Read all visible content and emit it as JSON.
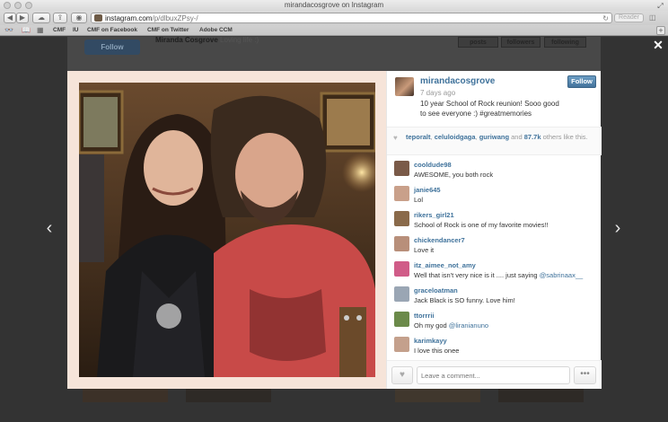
{
  "window": {
    "title": "mirandacosgrove on Instagram"
  },
  "toolbar": {
    "url_host": "instagram.com",
    "url_path": "/p/dlbuxZPsy-/",
    "reader_label": "Reader"
  },
  "bookmarks": {
    "items": [
      "CMF",
      "IU",
      "CMF on Facebook",
      "CMF on Twitter",
      "Adobe CCM"
    ]
  },
  "background_page": {
    "follow_label": "Follow",
    "profile_name": "Miranda Cosgrove",
    "profile_tagline": "Loving life :)",
    "stats": [
      "posts",
      "followers",
      "following"
    ]
  },
  "post": {
    "owner": "mirandacosgrove",
    "time": "7 days ago",
    "caption": "10 year School of Rock reunion! Sooo good to see everyone :) #greatmemories",
    "follow_label": "Follow"
  },
  "likes": {
    "users": [
      "teporalt",
      "celuloidgaga",
      "guriwang"
    ],
    "connector": "and",
    "others": "87.7k",
    "suffix": "others like this."
  },
  "comments": [
    {
      "user": "cooldude98",
      "text": "AWESOME, you both rock",
      "mention": ""
    },
    {
      "user": "janie645",
      "text": "Lol",
      "mention": ""
    },
    {
      "user": "rikers_girl21",
      "text": "School of Rock is one of my favorite movies!!",
      "mention": ""
    },
    {
      "user": "chickendancer7",
      "text": "Love it",
      "mention": ""
    },
    {
      "user": "itz_aimee_not_amy",
      "text": "Well that isn't very nice is it .... just saying ",
      "mention": "@sabrinaax__"
    },
    {
      "user": "graceloatman",
      "text": "Jack Black is SO funny. Love him!",
      "mention": ""
    },
    {
      "user": "ttorrrii",
      "text": "Oh my god ",
      "mention": "@liranianuno"
    },
    {
      "user": "karimkayy",
      "text": "I love this onee",
      "mention": ""
    }
  ],
  "composer": {
    "placeholder": "Leave a comment...",
    "more_label": "•••"
  },
  "icons": {
    "close": "close-icon",
    "prev": "chevron-left-icon",
    "next": "chevron-right-icon",
    "heart": "heart-icon"
  },
  "colors": {
    "link": "#3f729b",
    "follow_button": "#517fa4",
    "overlay": "#333333",
    "photo_border": "#f6e4d9"
  }
}
